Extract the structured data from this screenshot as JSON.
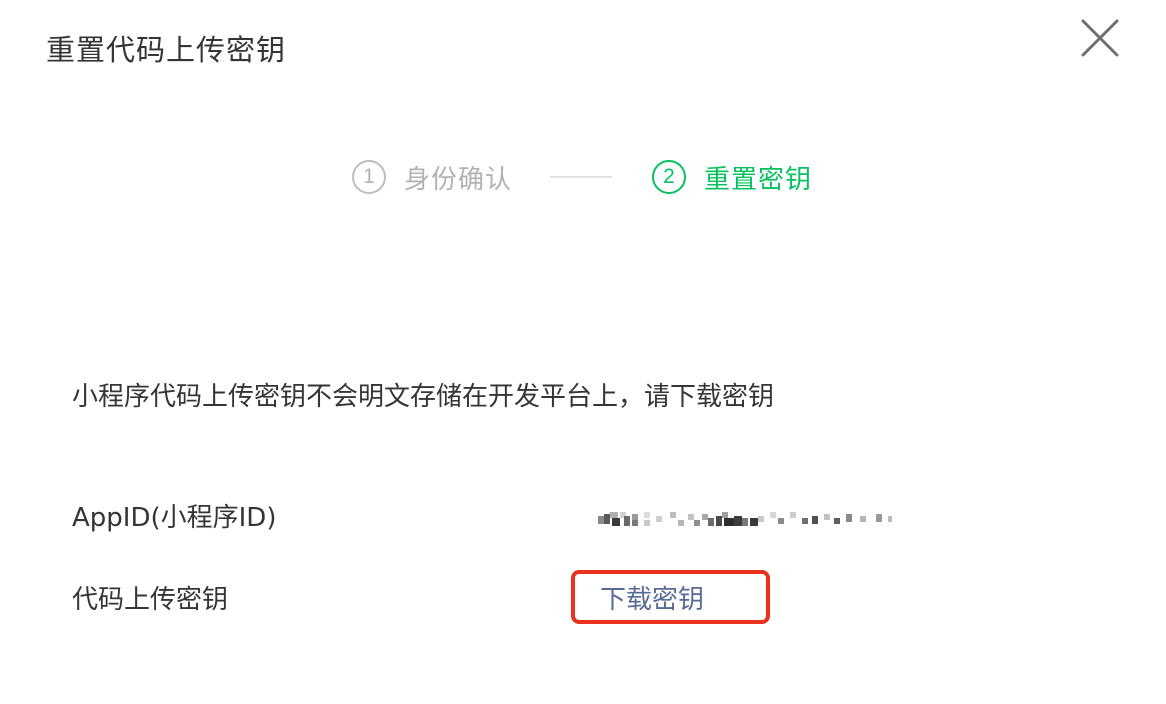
{
  "dialog": {
    "title": "重置代码上传密钥",
    "close_icon": "close-icon"
  },
  "steps": [
    {
      "number": "1",
      "label": "身份确认",
      "active": false
    },
    {
      "number": "2",
      "label": "重置密钥",
      "active": true
    }
  ],
  "notice": "小程序代码上传密钥不会明文存储在开发平台上，请下载密钥",
  "fields": {
    "appid_label": "AppID(小程序ID)",
    "key_label": "代码上传密钥",
    "download_link": "下载密钥"
  },
  "colors": {
    "accent_green": "#07c160",
    "link_blue": "#576b95",
    "highlight_red": "#e8321e",
    "inactive_gray": "#b2b2b2"
  }
}
